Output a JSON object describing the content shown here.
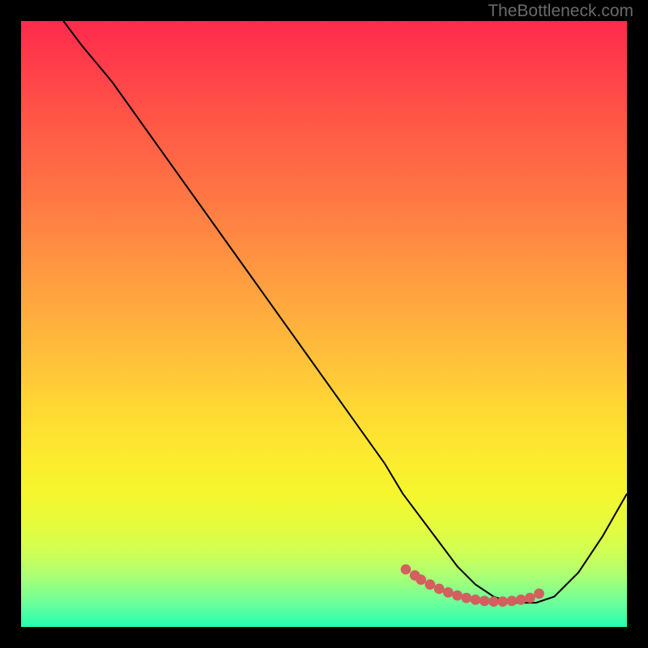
{
  "watermark": "TheBottleneck.com",
  "chart_data": {
    "type": "line",
    "title": "",
    "xlabel": "",
    "ylabel": "",
    "xlim": [
      0,
      100
    ],
    "ylim": [
      0,
      100
    ],
    "series": [
      {
        "name": "curve",
        "x": [
          7,
          10,
          15,
          20,
          25,
          30,
          35,
          40,
          45,
          50,
          55,
          60,
          63,
          66,
          69,
          72,
          75,
          78,
          81,
          83,
          85,
          88,
          92,
          96,
          100
        ],
        "y": [
          100,
          96,
          90,
          83,
          76,
          69,
          62,
          55,
          48,
          41,
          34,
          27,
          22,
          18,
          14,
          10,
          7,
          5,
          4,
          4,
          4,
          5,
          9,
          15,
          22
        ]
      }
    ],
    "markers": {
      "name": "highlight-dots",
      "x": [
        63.5,
        65,
        66,
        67.5,
        69,
        70.5,
        72,
        73.5,
        75,
        76.5,
        78,
        79.5,
        81,
        82.5,
        84,
        85.5
      ],
      "y": [
        9.5,
        8.5,
        7.8,
        7.0,
        6.3,
        5.7,
        5.2,
        4.8,
        4.5,
        4.3,
        4.2,
        4.2,
        4.3,
        4.5,
        4.8,
        5.5
      ]
    },
    "colors": {
      "top": "#ff2a4d",
      "mid": "#ffd934",
      "bottom": "#22ffb0",
      "curve": "#000000",
      "markers": "#d1605e"
    }
  }
}
